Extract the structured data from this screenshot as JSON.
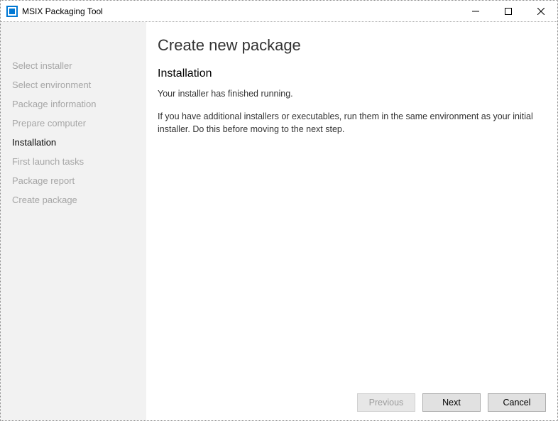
{
  "titlebar": {
    "title": "MSIX Packaging Tool"
  },
  "sidebar": {
    "items": [
      {
        "label": "Select installer",
        "active": false
      },
      {
        "label": "Select environment",
        "active": false
      },
      {
        "label": "Package information",
        "active": false
      },
      {
        "label": "Prepare computer",
        "active": false
      },
      {
        "label": "Installation",
        "active": true
      },
      {
        "label": "First launch tasks",
        "active": false
      },
      {
        "label": "Package report",
        "active": false
      },
      {
        "label": "Create package",
        "active": false
      }
    ]
  },
  "main": {
    "page_title": "Create new package",
    "section_title": "Installation",
    "text1": "Your installer has finished running.",
    "text2": "If you have additional installers or executables, run them in the same environment as your initial installer. Do this before moving to the next step."
  },
  "footer": {
    "previous": "Previous",
    "next": "Next",
    "cancel": "Cancel"
  }
}
